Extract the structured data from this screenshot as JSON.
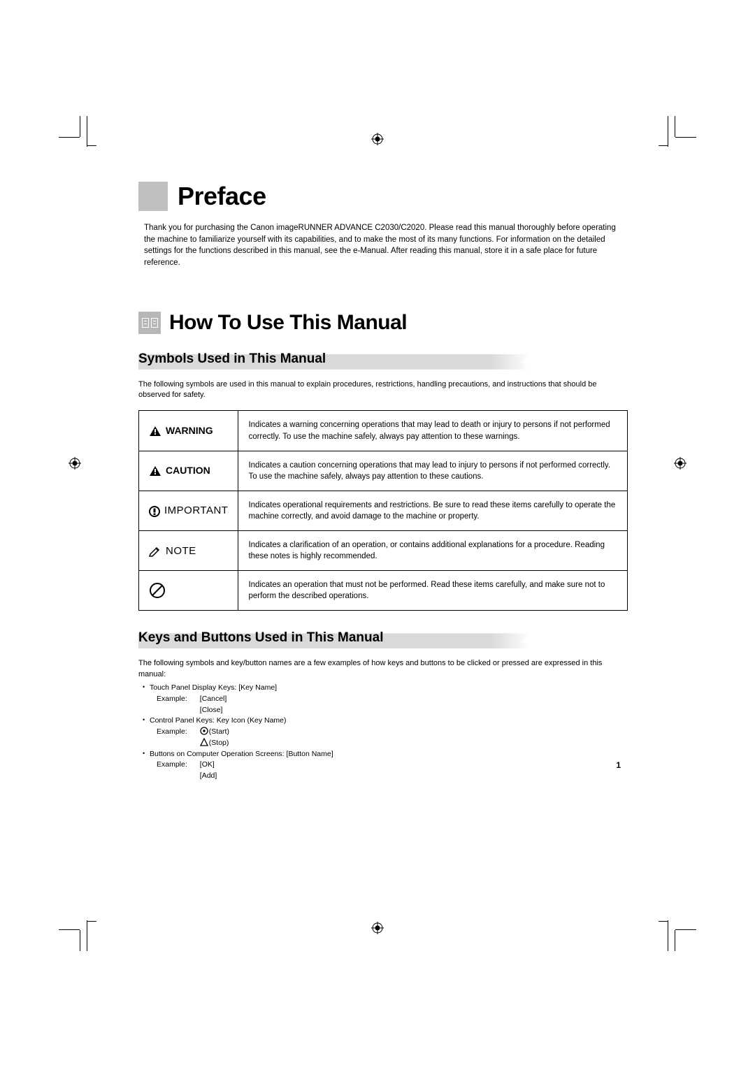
{
  "preface": {
    "title": "Preface",
    "intro": "Thank you for purchasing the Canon imageRUNNER ADVANCE C2030/C2020. Please read this manual thoroughly before operating the machine to familiarize yourself with its capabilities, and to make the most of its many functions. For information on the detailed settings for the functions described in this manual, see the e-Manual. After reading this manual, store it in a safe place for future reference."
  },
  "howto": {
    "title": "How To Use This Manual"
  },
  "symbols_section": {
    "heading": "Symbols Used in This Manual",
    "lead": "The following symbols are used in this manual to explain procedures, restrictions, handling precautions, and instructions that should be observed for safety.",
    "rows": {
      "warning": {
        "label": "WARNING",
        "text": "Indicates a warning concerning operations that may lead to death or injury to persons if not performed correctly. To use the machine safely, always pay attention to these warnings."
      },
      "caution": {
        "label": "CAUTION",
        "text": "Indicates a caution concerning operations that may lead to injury to persons if not performed correctly. To use the machine safely, always pay attention to these cautions."
      },
      "important": {
        "label": "IMPORTANT",
        "text": "Indicates operational requirements and restrictions. Be sure to read these items carefully to operate the machine correctly, and avoid damage to the machine or property."
      },
      "note": {
        "label": "NOTE",
        "text": "Indicates a clarification of an operation, or contains additional explanations for a procedure. Reading these notes is highly recommended."
      },
      "prohibit": {
        "label": "",
        "text": "Indicates an operation that must not be performed. Read these items carefully, and make sure not to perform the described operations."
      }
    }
  },
  "keys_section": {
    "heading": "Keys and Buttons Used in This Manual",
    "lead": "The following symbols and key/button names are a few examples of how keys and buttons to be clicked or pressed are expressed in this manual:",
    "items": {
      "touch": {
        "title": "Touch Panel Display Keys: [Key Name]",
        "example_label": "Example:",
        "ex1": "[Cancel]",
        "ex2": "[Close]"
      },
      "control": {
        "title": "Control Panel Keys: Key Icon (Key Name)",
        "example_label": "Example:",
        "ex1": "(Start)",
        "ex2": "(Stop)"
      },
      "buttons": {
        "title": "Buttons on Computer Operation Screens: [Button Name]",
        "example_label": "Example:",
        "ex1": "[OK]",
        "ex2": "[Add]"
      }
    }
  },
  "page_number": "1"
}
